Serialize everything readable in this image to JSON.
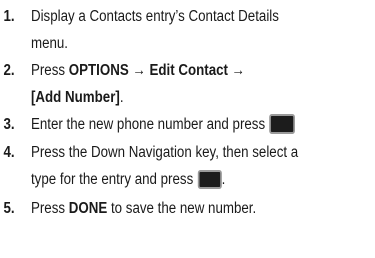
{
  "steps": [
    {
      "number": "1.",
      "lines": [
        "Display a Contacts entry’s Contact Details",
        "menu."
      ]
    },
    {
      "number": "2.",
      "pre": "Press ",
      "bold1": "OPTIONS  → Edit Contact →",
      "bold2": "[Add Number]",
      "post": "."
    },
    {
      "number": "3.",
      "text": "Enter the new phone number and press",
      "icon": "black-key-icon"
    },
    {
      "number": "4.",
      "line1": "Press the Down Navigation key, then select a",
      "line2": "type for the entry and press",
      "post": ".",
      "icon": "black-key-icon"
    },
    {
      "number": "5.",
      "pre": "Press ",
      "bold": "DONE",
      "post": " to save the new number."
    }
  ]
}
